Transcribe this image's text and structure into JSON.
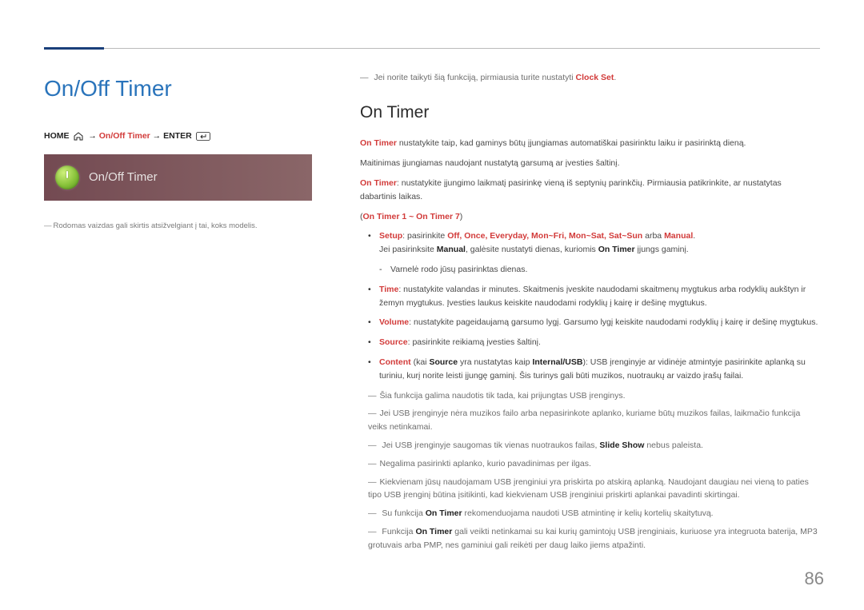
{
  "section_title": "On/Off Timer",
  "breadcrumb": {
    "home": "HOME",
    "path": "On/Off Timer",
    "enter": "ENTER"
  },
  "tile_label": "On/Off Timer",
  "left_disclaimer": "Rodomas vaizdas gali skirtis atsižvelgiant į tai, koks modelis.",
  "top_note_prefix": "Jei norite taikyti šią funkciją, pirmiausia turite nustatyti ",
  "top_note_bold": "Clock Set",
  "sub_heading": "On Timer",
  "paragraphs": {
    "p1_a": "On Timer",
    "p1_b": " nustatykite taip, kad gaminys būtų įjungiamas automatiškai pasirinktu laiku ir pasirinktą dieną.",
    "p2": "Maitinimas įjungiamas naudojant nustatytą garsumą ar įvesties šaltinį.",
    "p3_a": "On Timer",
    "p3_b": ": nustatykite įjungimo laikmatį pasirinkę vieną iš septynių parinkčių. Pirmiausia patikrinkite, ar nustatytas dabartinis laikas.",
    "range": "On Timer 1 ~ On Timer 7"
  },
  "bullets": {
    "setup_label": "Setup",
    "setup_text_a": ": pasirinkite ",
    "setup_opts": "Off, Once, Everyday, Mon~Fri, Mon~Sat, Sat~Sun",
    "setup_text_b": " arba ",
    "setup_opt_manual": "Manual",
    "setup_line2_a": "Jei pasirinksite ",
    "setup_line2_b": ", galėsite nustatyti dienas, kuriomis ",
    "setup_line2_c": " įjungs gaminį.",
    "setup_dash": "Varnelė rodo jūsų pasirinktas dienas.",
    "time_label": "Time",
    "time_text": ": nustatykite valandas ir minutes. Skaitmenis įveskite naudodami skaitmenų mygtukus arba rodyklių aukštyn ir žemyn mygtukus. Įvesties laukus keiskite naudodami rodyklių į kairę ir dešinę mygtukus.",
    "volume_label": "Volume",
    "volume_text": ": nustatykite pageidaujamą garsumo lygį. Garsumo lygį keiskite naudodami rodyklių į kairę ir dešinę mygtukus.",
    "source_label": "Source",
    "source_text": ": pasirinkite reikiamą įvesties šaltinį.",
    "content_label": "Content",
    "content_text_a": " (kai ",
    "content_text_b": " yra nustatytas kaip ",
    "content_iusb": "Internal/USB",
    "content_text_c": "): USB įrenginyje ar vidinėje atmintyje pasirinkite aplanką su turiniu, kurį norite leisti įjungę gaminį. Šis turinys gali būti muzikos, nuotraukų ar vaizdo įrašų failai."
  },
  "notes": {
    "n1": "Šia funkcija galima naudotis tik tada, kai prijungtas USB įrenginys.",
    "n2": "Jei USB įrenginyje nėra muzikos failo arba nepasirinkote aplanko, kuriame būtų muzikos failas, laikmačio funkcija veiks netinkamai.",
    "n3_a": "Jei USB įrenginyje saugomas tik vienas nuotraukos failas, ",
    "n3_bold": "Slide Show",
    "n3_b": " nebus paleista.",
    "n4": "Negalima pasirinkti aplanko, kurio pavadinimas per ilgas.",
    "n5": "Kiekvienam jūsų naudojamam USB įrenginiui yra priskirta po atskirą aplanką. Naudojant daugiau nei vieną to paties tipo USB įrenginį būtina įsitikinti, kad kiekvienam USB įrenginiui priskirti aplankai pavadinti skirtingai.",
    "n6_a": "Su funkcija ",
    "n6_bold": "On Timer",
    "n6_b": " rekomenduojama naudoti USB atmintinę ir kelių kortelių skaitytuvą.",
    "n7_a": "Funkcija ",
    "n7_bold": "On Timer",
    "n7_b": " gali veikti netinkamai su kai kurių gamintojų USB įrenginiais, kuriuose yra integruota baterija, MP3 grotuvais arba PMP, nes gaminiui gali reikėti per daug laiko jiems atpažinti."
  },
  "page_number": "86"
}
